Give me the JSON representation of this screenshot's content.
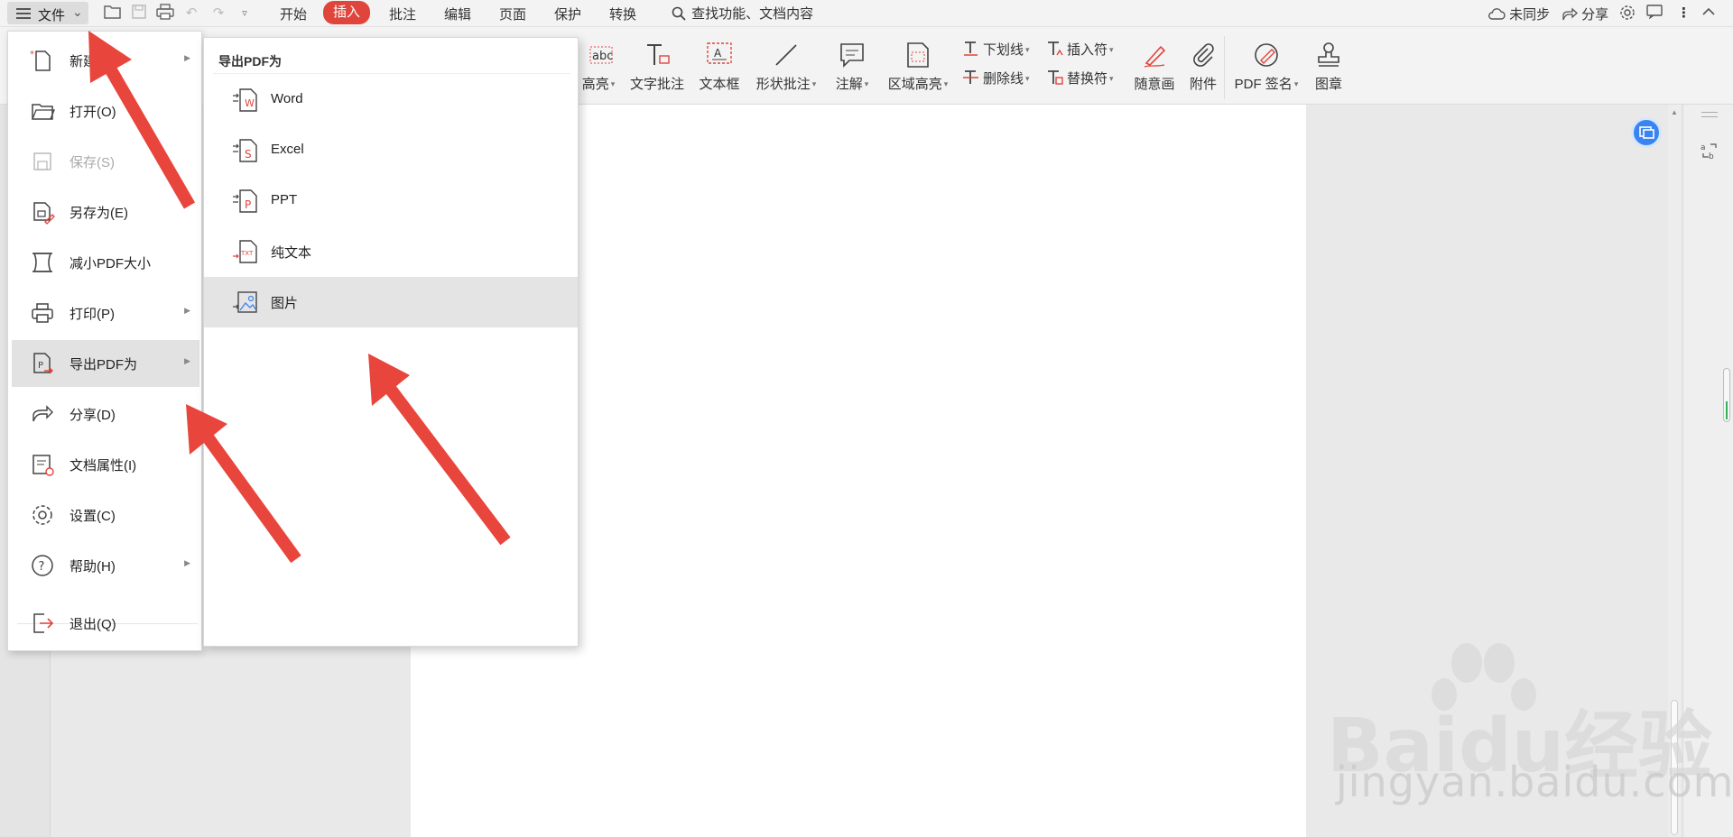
{
  "topbar": {
    "file_label": "文件",
    "tabs": [
      "开始",
      "插入",
      "批注",
      "编辑",
      "页面",
      "保护",
      "转换"
    ],
    "active_tab": "插入",
    "search_text": "查找功能、文档内容",
    "sync_label": "未同步",
    "share_label": "分享"
  },
  "ribbon": {
    "highlight": "高亮",
    "text_note": "文字批注",
    "text_box": "文本框",
    "shape_note": "形状批注",
    "annotate": "注解",
    "area_highlight": "区域高亮",
    "underline": "下划线",
    "strikethrough": "删除线",
    "insert_mark": "插入符",
    "replace_mark": "替换符",
    "freehand": "随意画",
    "attachment": "附件",
    "pdf_sign": "PDF 签名",
    "stamp": "图章"
  },
  "file_menu": {
    "items": [
      {
        "label": "新建(N)",
        "icon": "new-file-icon",
        "submenu": true,
        "disabled": false
      },
      {
        "label": "打开(O)",
        "icon": "folder-open-icon",
        "submenu": false,
        "disabled": false
      },
      {
        "label": "保存(S)",
        "icon": "save-icon",
        "submenu": false,
        "disabled": true
      },
      {
        "label": "另存为(E)",
        "icon": "save-as-icon",
        "submenu": false,
        "disabled": false
      },
      {
        "label": "减小PDF大小",
        "icon": "compress-icon",
        "submenu": false,
        "disabled": false
      },
      {
        "label": "打印(P)",
        "icon": "printer-icon",
        "submenu": true,
        "disabled": false
      },
      {
        "label": "导出PDF为",
        "icon": "export-pdf-icon",
        "submenu": true,
        "disabled": false,
        "selected": true
      },
      {
        "label": "分享(D)",
        "icon": "share-icon",
        "submenu": false,
        "disabled": false
      },
      {
        "label": "文档属性(I)",
        "icon": "doc-properties-icon",
        "submenu": false,
        "disabled": false
      },
      {
        "label": "设置(C)",
        "icon": "settings-icon",
        "submenu": false,
        "disabled": false
      },
      {
        "label": "帮助(H)",
        "icon": "help-icon",
        "submenu": true,
        "disabled": false
      },
      {
        "label": "退出(Q)",
        "icon": "exit-icon",
        "submenu": false,
        "disabled": false
      }
    ]
  },
  "export_submenu": {
    "title": "导出PDF为",
    "items": [
      {
        "label": "Word",
        "icon": "word-export-icon"
      },
      {
        "label": "Excel",
        "icon": "excel-export-icon"
      },
      {
        "label": "PPT",
        "icon": "ppt-export-icon"
      },
      {
        "label": "纯文本",
        "icon": "txt-export-icon"
      },
      {
        "label": "图片",
        "icon": "image-export-icon",
        "selected": true
      }
    ]
  },
  "watermark": {
    "brand": "Baidu经验",
    "url": "jingyan.baidu.com"
  },
  "colors": {
    "accent": "#e0453b",
    "arrow": "#e8453c",
    "badge_blue": "#3a84f1"
  }
}
